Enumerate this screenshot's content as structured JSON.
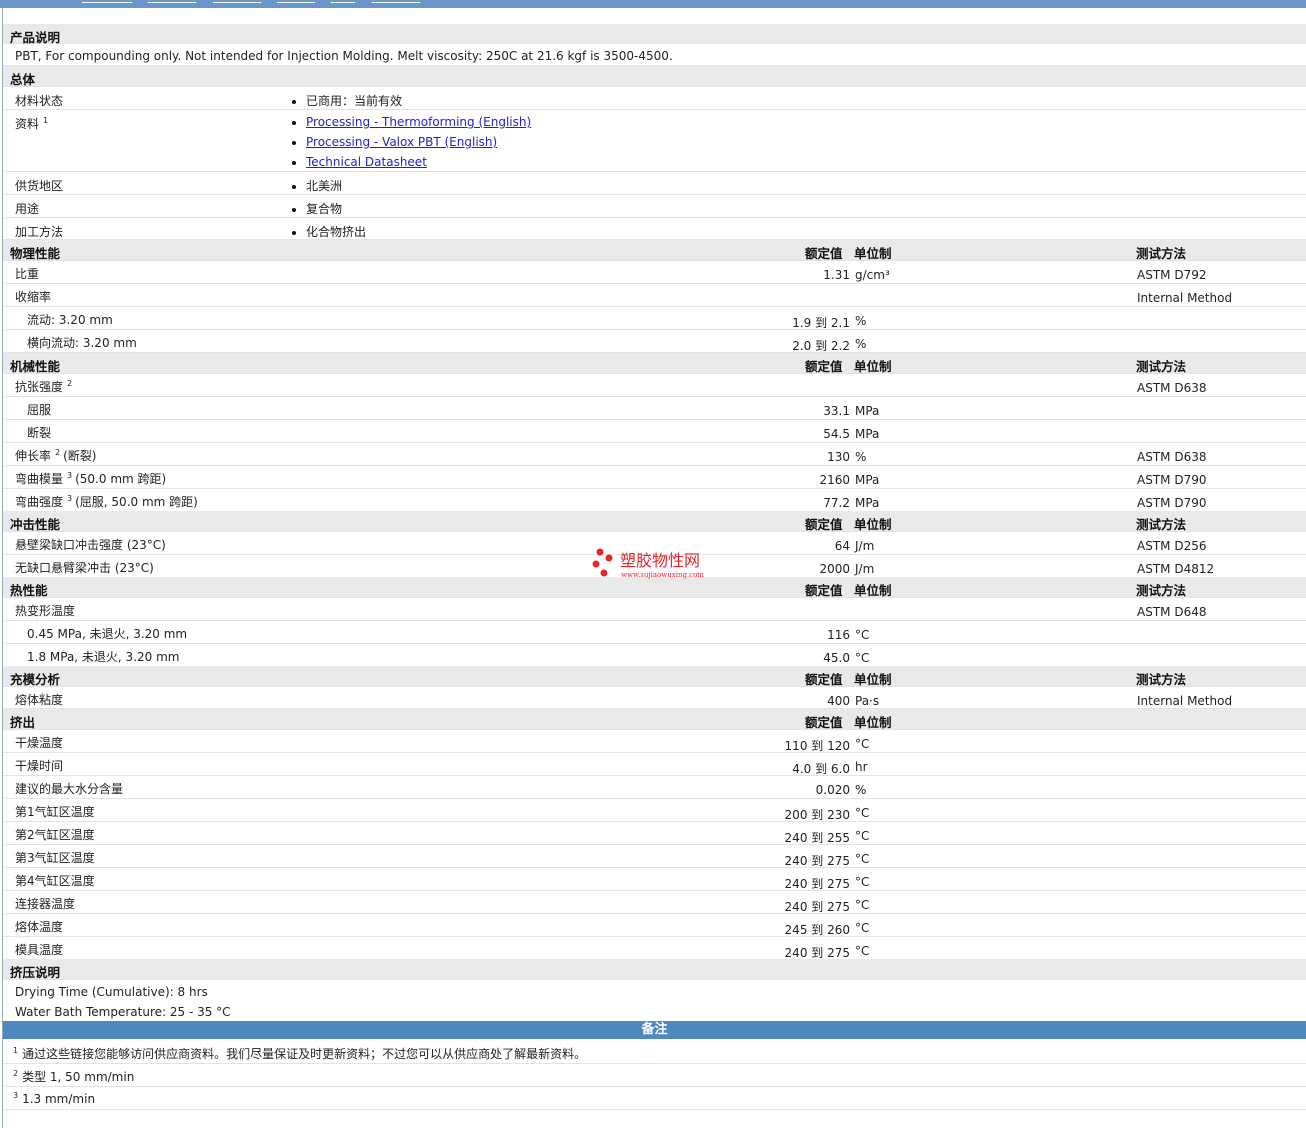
{
  "product_desc": {
    "heading": "产品说明",
    "text": "PBT, For compounding only. Not intended for Injection Molding. Melt viscosity: 250C at 21.6 kgf is 3500-4500."
  },
  "general": {
    "heading": "总体",
    "material_status_label": "材料状态",
    "material_status_value": "已商用：当前有效",
    "docs_label": "资料",
    "docs_sup": "1",
    "docs_links": [
      "Processing - Thermoforming (English)",
      "Processing - Valox PBT (English)",
      "Technical Datasheet"
    ],
    "region_label": "供货地区",
    "region_value": "北美洲",
    "uses_label": "用途",
    "uses_value": "复合物",
    "process_label": "加工方法",
    "process_value": "化合物挤出"
  },
  "col_headers": {
    "nominal": "额定值",
    "unit": "单位制",
    "method": "测试方法"
  },
  "physical": {
    "heading": "物理性能",
    "rows": [
      {
        "label": "比重",
        "value": "1.31",
        "unit": "g/cm³",
        "method": "ASTM D792"
      },
      {
        "label": "收缩率",
        "value": "",
        "unit": "",
        "method": "Internal Method"
      },
      {
        "label": "流动: 3.20 mm",
        "value": "1.9 到  2.1",
        "unit": "%",
        "method": ""
      },
      {
        "label": "横向流动: 3.20 mm",
        "value": "2.0 到  2.2",
        "unit": "%",
        "method": ""
      }
    ]
  },
  "mechanical": {
    "heading": "机械性能",
    "rows": [
      {
        "label": "抗张强度",
        "sup": "2",
        "suffix": "",
        "value": "",
        "unit": "",
        "method": "ASTM D638"
      },
      {
        "label": "屈服",
        "value": "33.1",
        "unit": "MPa",
        "method": ""
      },
      {
        "label": "断裂",
        "value": "54.5",
        "unit": "MPa",
        "method": ""
      },
      {
        "label": "伸长率",
        "sup": "2",
        "suffix": "(断裂)",
        "value": "130",
        "unit": "%",
        "method": "ASTM D638"
      },
      {
        "label": "弯曲模量",
        "sup": "3",
        "suffix": "(50.0 mm 跨距)",
        "value": "2160",
        "unit": "MPa",
        "method": "ASTM D790"
      },
      {
        "label": "弯曲强度",
        "sup": "3",
        "suffix": "(屈服, 50.0 mm 跨距)",
        "value": "77.2",
        "unit": "MPa",
        "method": "ASTM D790"
      }
    ]
  },
  "impact": {
    "heading": "冲击性能",
    "rows": [
      {
        "label": "悬壁梁缺口冲击强度 (23°C)",
        "value": "64",
        "unit": "J/m",
        "method": "ASTM D256"
      },
      {
        "label": "无缺口悬臂梁冲击 (23°C)",
        "value": "2000",
        "unit": "J/m",
        "method": "ASTM D4812"
      }
    ]
  },
  "thermal": {
    "heading": "热性能",
    "rows": [
      {
        "label": "热变形温度",
        "value": "",
        "unit": "",
        "method": "ASTM D648"
      },
      {
        "label": "0.45 MPa, 未退火, 3.20 mm",
        "value": "116",
        "unit": "°C",
        "method": ""
      },
      {
        "label": "1.8 MPa, 未退火, 3.20 mm",
        "value": "45.0",
        "unit": "°C",
        "method": ""
      }
    ]
  },
  "filling": {
    "heading": "充模分析",
    "rows": [
      {
        "label": "熔体粘度",
        "value": "400",
        "unit": "Pa·s",
        "method": "Internal Method"
      }
    ]
  },
  "extrusion": {
    "heading": "挤出",
    "rows": [
      {
        "label": "干燥温度",
        "value": "110 到  120",
        "unit": "°C"
      },
      {
        "label": "干燥时间",
        "value": "4.0 到  6.0",
        "unit": "hr"
      },
      {
        "label": "建议的最大水分含量",
        "value": "0.020",
        "unit": "%"
      },
      {
        "label": "第1气缸区温度",
        "value": "200 到  230",
        "unit": "°C"
      },
      {
        "label": "第2气缸区温度",
        "value": "240 到  255",
        "unit": "°C"
      },
      {
        "label": "第3气缸区温度",
        "value": "240 到  275",
        "unit": "°C"
      },
      {
        "label": "第4气缸区温度",
        "value": "240 到  275",
        "unit": "°C"
      },
      {
        "label": "连接器温度",
        "value": "240 到  275",
        "unit": "°C"
      },
      {
        "label": "熔体温度",
        "value": "245 到  260",
        "unit": "°C"
      },
      {
        "label": "模具温度",
        "value": "240 到  275",
        "unit": "°C"
      }
    ]
  },
  "extrusion_notes": {
    "heading": "挤压说明",
    "lines": [
      "Drying Time (Cumulative): 8 hrs",
      "Water Bath Temperature: 25 - 35 °C"
    ]
  },
  "notes": {
    "heading": "备注",
    "items": [
      {
        "sup": "1",
        "text": "通过这些链接您能够访问供应商资料。我们尽量保证及时更新资料；不过您可以从供应商处了解最新资料。"
      },
      {
        "sup": "2",
        "text": "类型  1, 50 mm/min"
      },
      {
        "sup": "3",
        "text": "1.3 mm/min"
      }
    ]
  },
  "watermark": {
    "title": "塑胶物性网",
    "url": "www.sujiaowuxing.com"
  },
  "colors": {
    "banner": "#4f87bf",
    "header_bg": "#e9e9e9",
    "link": "#2222cc",
    "watermark": "#e8252b"
  }
}
